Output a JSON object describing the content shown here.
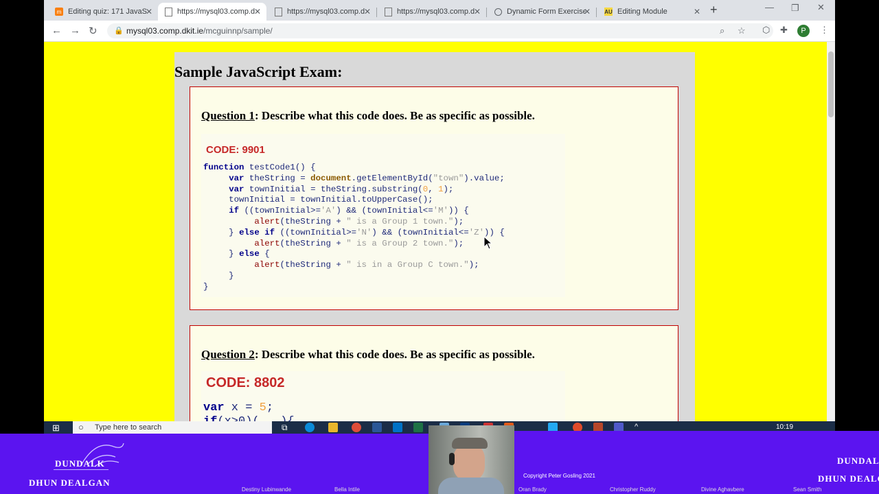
{
  "browser": {
    "tabs": [
      {
        "title": "Editing quiz: 171 JavaSc",
        "icon": "moodle-icon"
      },
      {
        "title": "https://mysql03.comp.d",
        "icon": "page-icon",
        "active": true
      },
      {
        "title": "https://mysql03.comp.d",
        "icon": "page-icon"
      },
      {
        "title": "https://mysql03.comp.d",
        "icon": "page-icon"
      },
      {
        "title": "Dynamic Form Exercise",
        "icon": "globe-icon"
      },
      {
        "title": "Editing Module",
        "icon": "au-icon"
      }
    ],
    "new_tab": "+",
    "url_host": "mysql03.comp.dkit.ie",
    "url_path": "/mcguinnp/sample/",
    "profile_initial": "P"
  },
  "page": {
    "title": "Sample JavaScript Exam:",
    "questions": [
      {
        "number": "Question 1",
        "prompt": ": Describe what this code does. Be as specific as possible.",
        "code_label": "CODE: 9901"
      },
      {
        "number": "Question 2",
        "prompt": ": Describe what this code does. Be as specific as possible.",
        "code_label": "CODE: 8802"
      }
    ]
  },
  "taskbar": {
    "search_placeholder": "Type here to search",
    "clock": "10:19"
  },
  "overlay": {
    "copyright": "Copyright Peter Gosling 2021",
    "logo_top": "DUNDALK",
    "logo_bottom": "DHUN DEALGAN",
    "participants": [
      "Destiny Lubinwande",
      "Bella Intile",
      "Oran Brady",
      "Christopher Ruddy",
      "Divine Aghavbere",
      "Sean Smith"
    ]
  },
  "colors": {
    "page_background": "#ffff00",
    "banner": "#5b14f0",
    "question_border": "#c00000",
    "code_label": "#c62828"
  }
}
